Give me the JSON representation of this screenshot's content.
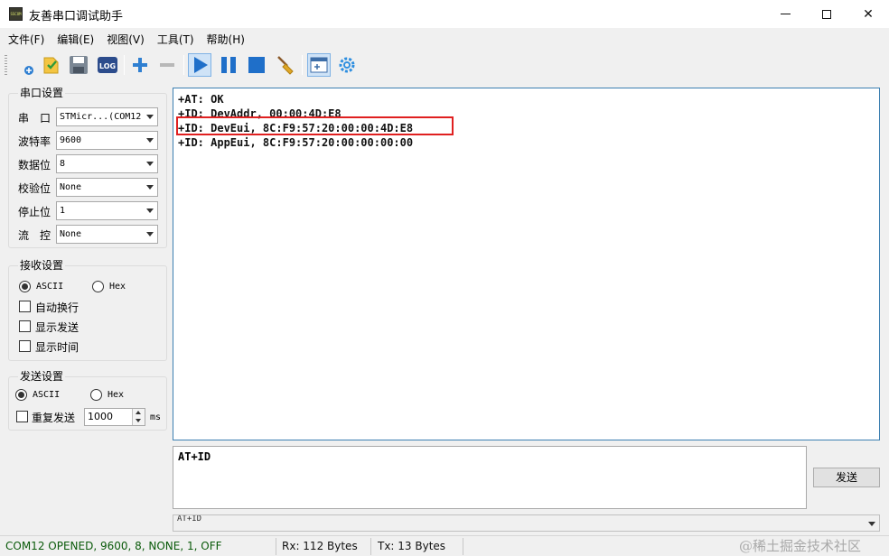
{
  "window": {
    "title": "友善串口调试助手",
    "app_icon_text": "SSCOM",
    "min_label": "minimize",
    "max_label": "maximize",
    "close_label": "✕"
  },
  "menu": [
    "文件(F)",
    "编辑(E)",
    "视图(V)",
    "工具(T)",
    "帮助(H)"
  ],
  "toolbar": {
    "icons": [
      "new-icon",
      "open-icon",
      "save-icon",
      "log-icon",
      "add-icon",
      "remove-icon",
      "play-icon",
      "pause-icon",
      "stop-icon",
      "clear-broom-icon",
      "window-icon",
      "settings-gear-icon"
    ],
    "log_label": "LOG"
  },
  "serial_settings": {
    "title": "串口设置",
    "fields": [
      {
        "label": "串　口",
        "value": "STMicr...(COM12"
      },
      {
        "label": "波特率",
        "value": "9600"
      },
      {
        "label": "数据位",
        "value": "8"
      },
      {
        "label": "校验位",
        "value": "None"
      },
      {
        "label": "停止位",
        "value": "1"
      },
      {
        "label": "流　控",
        "value": "None"
      }
    ]
  },
  "receive_settings": {
    "title": "接收设置",
    "ascii_label": "ASCII",
    "hex_label": "Hex",
    "mode_selected": "ASCII",
    "options": [
      {
        "label": "自动换行",
        "checked": false
      },
      {
        "label": "显示发送",
        "checked": false
      },
      {
        "label": "显示时间",
        "checked": false
      }
    ]
  },
  "send_settings": {
    "title": "发送设置",
    "ascii_label": "ASCII",
    "hex_label": "Hex",
    "mode_selected": "ASCII",
    "repeat_label": "重复发送",
    "repeat_checked": false,
    "interval": "1000",
    "unit": "ms"
  },
  "receive_text": [
    "+AT: OK",
    "+ID: DevAddr, 00:00:4D:E8",
    "+ID: DevEui, 8C:F9:57:20:00:00:4D:E8",
    "+ID: AppEui, 8C:F9:57:20:00:00:00:00"
  ],
  "send_text": "AT+ID",
  "send_button": "发送",
  "history_value": "AT+ID",
  "status": {
    "port": "COM12 OPENED, 9600, 8, NONE, 1, OFF",
    "rx": "Rx: 112 Bytes",
    "tx": "Tx: 13 Bytes",
    "watermark": "@稀土掘金技术社区"
  },
  "colors": {
    "accent_blue": "#2f7fd1",
    "highlight_red": "#e02020",
    "status_green": "#0a5a0a"
  }
}
